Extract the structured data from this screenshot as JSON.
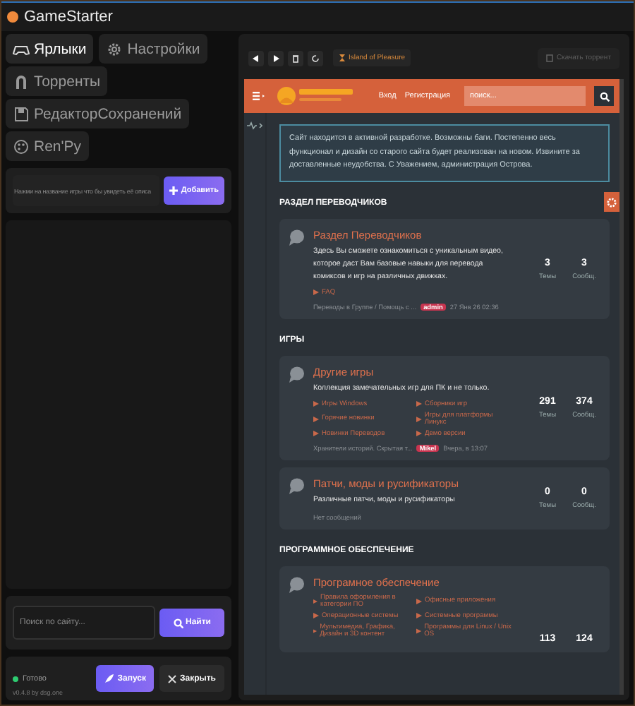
{
  "window": {
    "title": "GameStarter"
  },
  "tabs": [
    {
      "label": "Ярлыки",
      "selected": true
    },
    {
      "label": "Настройки",
      "selected": false
    },
    {
      "label": "Торренты",
      "selected": false
    },
    {
      "label": "РедакторСохранений",
      "selected": false
    },
    {
      "label": "Ren'Py",
      "selected": false
    }
  ],
  "game_input": {
    "placeholder": "Нажми на название игры что бы увидеть её описа",
    "button": "Добавить"
  },
  "site_search": {
    "placeholder": "Поиск по сайту...",
    "button": "Найти"
  },
  "status": {
    "text": "Готово",
    "version": "v0.4.8 by dsg.one"
  },
  "actions": [
    {
      "kind": "primary",
      "label": "Запуск"
    },
    {
      "kind": "close",
      "label": "Закрыть"
    }
  ],
  "browser": {
    "tab": "Island of Pleasure",
    "download_button": {
      "label": "Скачать торрент",
      "disabled": true
    },
    "site": {
      "nav": [
        "Вход",
        "Регистрация"
      ],
      "search_placeholder": "поиск...",
      "notice": "Сайт находится в активной разработке. Возможны баги. Постепенно весь функционал и дизайн со старого сайта будет реализован на новом. Извините за доставленные неудобства. С Уважением, администрация Острова.",
      "sections": [
        {
          "title": "РАЗДЕЛ ПЕРЕВОДЧИКОВ",
          "forums": [
            {
              "title": "Раздел Переводчиков",
              "description": "Здесь Вы сможете ознакомиться с уникальным видео, которое даст Вам базовые навыки для перевода комиксов и игр на различных движках.",
              "subforums": [
                "FAQ"
              ],
              "stats": [
                {
                  "value": "3",
                  "label": "Темы"
                },
                {
                  "value": "3",
                  "label": "Сообщ."
                }
              ],
              "last_post": {
                "thread": "Переводы в Группе / Помощь с ...",
                "user": "admin",
                "date": "27 Янв 26 02:36"
              }
            }
          ]
        },
        {
          "title": "ИГРЫ",
          "forums": [
            {
              "title": "Другие игры",
              "description": "Коллекция замечательных игр для ПК и не только.",
              "subforums": [
                "Игры Windows",
                "Сборники игр",
                "Горячие новинки",
                "Игры для платформы Линукс",
                "Новинки Переводов",
                "Демо версии"
              ],
              "stats": [
                {
                  "value": "291",
                  "label": "Темы"
                },
                {
                  "value": "374",
                  "label": "Сообщ."
                }
              ],
              "last_post": {
                "thread": "Хранители историй. Скрытая т...",
                "user": "Mikel",
                "date": "Вчера, в 13:07"
              }
            },
            {
              "title": "Патчи, моды и русификаторы",
              "description": "Различные патчи, моды и русификаторы",
              "stats": [
                {
                  "value": "0",
                  "label": "Темы"
                },
                {
                  "value": "0",
                  "label": "Сообщ."
                }
              ],
              "empty_note": "Нет сообщений"
            }
          ]
        },
        {
          "title": "ПРОГРАММНОЕ ОБЕСПЕЧЕНИЕ",
          "forums": [
            {
              "title": "Програмное обеспечение",
              "subforums": [
                "Правила оформления в категории ПО",
                "Офисные приложения",
                "Операционные системы",
                "Системные программы",
                "Мультимедиа, Графика, Дизайн и 3D контент",
                "Программы для Linux / Unix OS"
              ],
              "stats": [
                {
                  "value": "113"
                },
                {
                  "value": "124"
                }
              ]
            }
          ]
        }
      ]
    }
  }
}
